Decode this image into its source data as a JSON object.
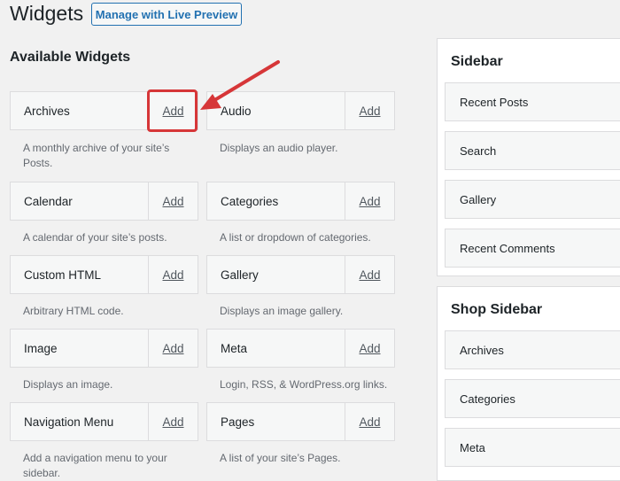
{
  "header": {
    "title": "Widgets",
    "live_preview_button": "Manage with Live Preview"
  },
  "available": {
    "title": "Available Widgets",
    "add_label": "Add",
    "widgets": [
      {
        "title": "Archives",
        "desc": "A monthly archive of your site’s Posts."
      },
      {
        "title": "Audio",
        "desc": "Displays an audio player."
      },
      {
        "title": "Calendar",
        "desc": "A calendar of your site’s posts."
      },
      {
        "title": "Categories",
        "desc": "A list or dropdown of categories."
      },
      {
        "title": "Custom HTML",
        "desc": "Arbitrary HTML code."
      },
      {
        "title": "Gallery",
        "desc": "Displays an image gallery."
      },
      {
        "title": "Image",
        "desc": "Displays an image."
      },
      {
        "title": "Meta",
        "desc": "Login, RSS, & WordPress.org links."
      },
      {
        "title": "Navigation Menu",
        "desc": "Add a navigation menu to your sidebar."
      },
      {
        "title": "Pages",
        "desc": "A list of your site’s Pages."
      }
    ]
  },
  "sidebars": [
    {
      "title": "Sidebar",
      "items": [
        "Recent Posts",
        "Search",
        "Gallery",
        "Recent Comments"
      ]
    },
    {
      "title": "Shop Sidebar",
      "items": [
        "Archives",
        "Categories",
        "Meta"
      ]
    }
  ],
  "colors": {
    "accent": "#2271b1",
    "highlight": "#d63638"
  }
}
